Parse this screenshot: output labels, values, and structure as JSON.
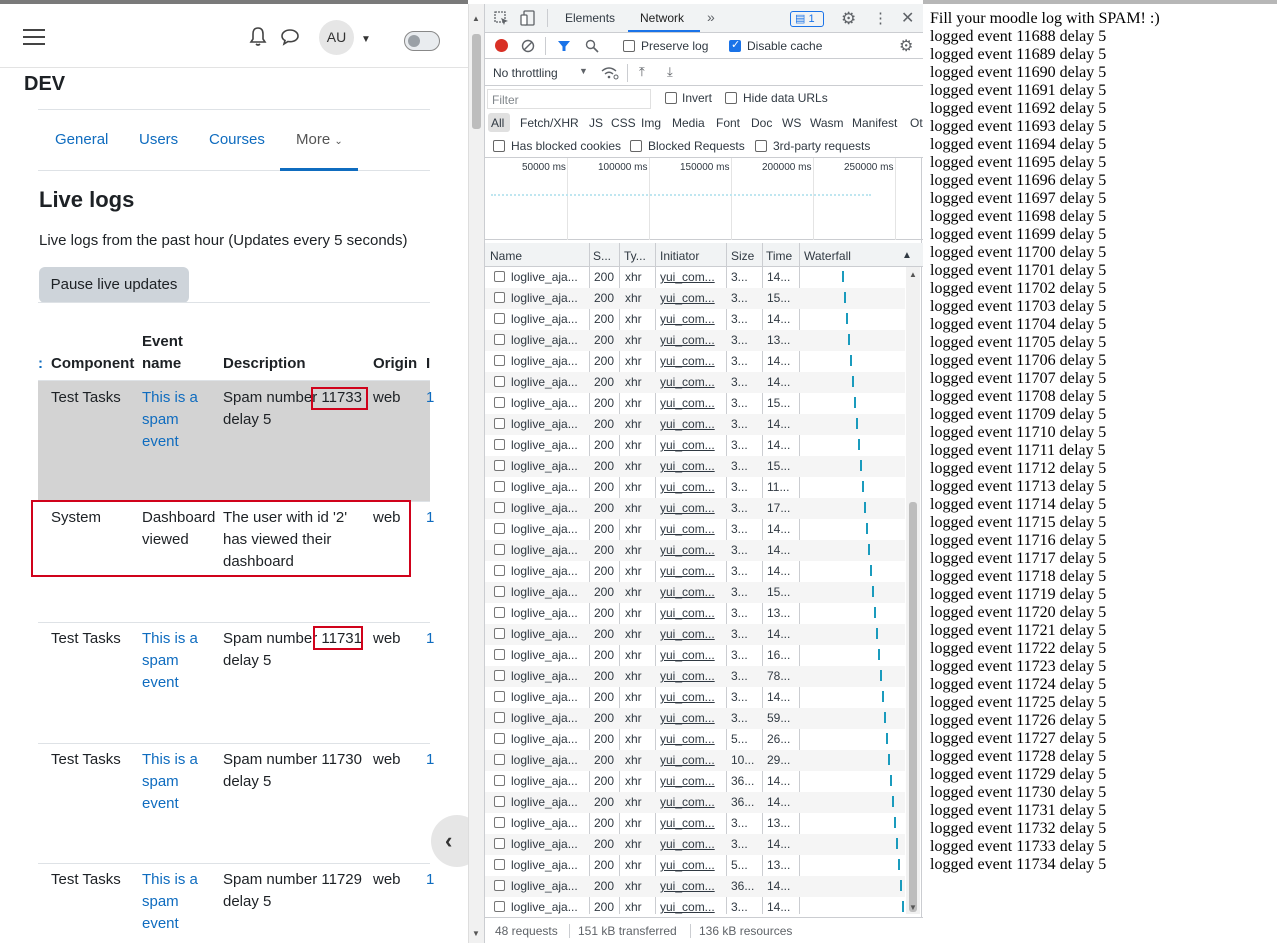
{
  "moodle": {
    "avatar_initials": "AU",
    "course_title": "DEV",
    "tabs": [
      {
        "label": "General"
      },
      {
        "label": "Users"
      },
      {
        "label": "Courses"
      },
      {
        "label": "More"
      }
    ],
    "heading": "Live logs",
    "subtitle": "Live logs from the past hour (Updates every 5 seconds)",
    "pause_button": "Pause live updates",
    "table": {
      "headers": {
        "component": "Component",
        "event_name_1": "Event",
        "event_name_2": "name",
        "description": "Description",
        "origin": "Origin"
      },
      "rows": [
        {
          "component": "Test Tasks",
          "event": [
            "This is a",
            "spam",
            "event"
          ],
          "desc": [
            "Spam number 11733",
            "delay 5"
          ],
          "origin": "web"
        },
        {
          "component": "System",
          "event": [
            "Dashboard",
            "viewed"
          ],
          "desc": [
            "The user with id '2'",
            "has viewed their",
            "dashboard"
          ],
          "origin": "web"
        },
        {
          "component": "Test Tasks",
          "event": [
            "This is a",
            "spam",
            "event"
          ],
          "desc": [
            "Spam number 11731",
            "delay 5"
          ],
          "origin": "web"
        },
        {
          "component": "Test Tasks",
          "event": [
            "This is a",
            "spam",
            "event"
          ],
          "desc": [
            "Spam number 11730",
            "delay 5"
          ],
          "origin": "web"
        },
        {
          "component": "Test Tasks",
          "event": [
            "This is a",
            "spam",
            "event"
          ],
          "desc": [
            "Spam number 11729",
            "delay 5"
          ],
          "origin": "web"
        }
      ]
    }
  },
  "devtools": {
    "tabs": {
      "elements": "Elements",
      "network": "Network",
      "more": "»"
    },
    "issues_count": "1",
    "preserve_log": "Preserve log",
    "disable_cache": "Disable cache",
    "throttling": "No throttling",
    "filter_placeholder": "Filter",
    "invert": "Invert",
    "hide_data_urls": "Hide data URLs",
    "type_filters": [
      "All",
      "Fetch/XHR",
      "JS",
      "CSS",
      "Img",
      "Media",
      "Font",
      "Doc",
      "WS",
      "Wasm",
      "Manifest",
      "Ot"
    ],
    "has_blocked_cookies": "Has blocked cookies",
    "blocked_requests": "Blocked Requests",
    "third_party": "3rd-party requests",
    "overview_ticks": [
      "50000 ms",
      "100000 ms",
      "150000 ms",
      "200000 ms",
      "250000 ms"
    ],
    "columns": {
      "name": "Name",
      "status": "S...",
      "type": "Ty...",
      "initiator": "Initiator",
      "size": "Size",
      "time": "Time",
      "waterfall": "Waterfall"
    },
    "requests": [
      {
        "name": "loglive_aja...",
        "status": "200",
        "type": "xhr",
        "initiator": "yui_com...",
        "size": "3...",
        "time": "14..."
      },
      {
        "name": "loglive_aja...",
        "status": "200",
        "type": "xhr",
        "initiator": "yui_com...",
        "size": "3...",
        "time": "15..."
      },
      {
        "name": "loglive_aja...",
        "status": "200",
        "type": "xhr",
        "initiator": "yui_com...",
        "size": "3...",
        "time": "14..."
      },
      {
        "name": "loglive_aja...",
        "status": "200",
        "type": "xhr",
        "initiator": "yui_com...",
        "size": "3...",
        "time": "13..."
      },
      {
        "name": "loglive_aja...",
        "status": "200",
        "type": "xhr",
        "initiator": "yui_com...",
        "size": "3...",
        "time": "14..."
      },
      {
        "name": "loglive_aja...",
        "status": "200",
        "type": "xhr",
        "initiator": "yui_com...",
        "size": "3...",
        "time": "14..."
      },
      {
        "name": "loglive_aja...",
        "status": "200",
        "type": "xhr",
        "initiator": "yui_com...",
        "size": "3...",
        "time": "15..."
      },
      {
        "name": "loglive_aja...",
        "status": "200",
        "type": "xhr",
        "initiator": "yui_com...",
        "size": "3...",
        "time": "14..."
      },
      {
        "name": "loglive_aja...",
        "status": "200",
        "type": "xhr",
        "initiator": "yui_com...",
        "size": "3...",
        "time": "14..."
      },
      {
        "name": "loglive_aja...",
        "status": "200",
        "type": "xhr",
        "initiator": "yui_com...",
        "size": "3...",
        "time": "15..."
      },
      {
        "name": "loglive_aja...",
        "status": "200",
        "type": "xhr",
        "initiator": "yui_com...",
        "size": "3...",
        "time": "11..."
      },
      {
        "name": "loglive_aja...",
        "status": "200",
        "type": "xhr",
        "initiator": "yui_com...",
        "size": "3...",
        "time": "17..."
      },
      {
        "name": "loglive_aja...",
        "status": "200",
        "type": "xhr",
        "initiator": "yui_com...",
        "size": "3...",
        "time": "14..."
      },
      {
        "name": "loglive_aja...",
        "status": "200",
        "type": "xhr",
        "initiator": "yui_com...",
        "size": "3...",
        "time": "14..."
      },
      {
        "name": "loglive_aja...",
        "status": "200",
        "type": "xhr",
        "initiator": "yui_com...",
        "size": "3...",
        "time": "14..."
      },
      {
        "name": "loglive_aja...",
        "status": "200",
        "type": "xhr",
        "initiator": "yui_com...",
        "size": "3...",
        "time": "15..."
      },
      {
        "name": "loglive_aja...",
        "status": "200",
        "type": "xhr",
        "initiator": "yui_com...",
        "size": "3...",
        "time": "13..."
      },
      {
        "name": "loglive_aja...",
        "status": "200",
        "type": "xhr",
        "initiator": "yui_com...",
        "size": "3...",
        "time": "14..."
      },
      {
        "name": "loglive_aja...",
        "status": "200",
        "type": "xhr",
        "initiator": "yui_com...",
        "size": "3...",
        "time": "16..."
      },
      {
        "name": "loglive_aja...",
        "status": "200",
        "type": "xhr",
        "initiator": "yui_com...",
        "size": "3...",
        "time": "78..."
      },
      {
        "name": "loglive_aja...",
        "status": "200",
        "type": "xhr",
        "initiator": "yui_com...",
        "size": "3...",
        "time": "14..."
      },
      {
        "name": "loglive_aja...",
        "status": "200",
        "type": "xhr",
        "initiator": "yui_com...",
        "size": "3...",
        "time": "59..."
      },
      {
        "name": "loglive_aja...",
        "status": "200",
        "type": "xhr",
        "initiator": "yui_com...",
        "size": "5...",
        "time": "26..."
      },
      {
        "name": "loglive_aja...",
        "status": "200",
        "type": "xhr",
        "initiator": "yui_com...",
        "size": "10...",
        "time": "29..."
      },
      {
        "name": "loglive_aja...",
        "status": "200",
        "type": "xhr",
        "initiator": "yui_com...",
        "size": "36...",
        "time": "14..."
      },
      {
        "name": "loglive_aja...",
        "status": "200",
        "type": "xhr",
        "initiator": "yui_com...",
        "size": "36...",
        "time": "14..."
      },
      {
        "name": "loglive_aja...",
        "status": "200",
        "type": "xhr",
        "initiator": "yui_com...",
        "size": "3...",
        "time": "13..."
      },
      {
        "name": "loglive_aja...",
        "status": "200",
        "type": "xhr",
        "initiator": "yui_com...",
        "size": "3...",
        "time": "14..."
      },
      {
        "name": "loglive_aja...",
        "status": "200",
        "type": "xhr",
        "initiator": "yui_com...",
        "size": "5...",
        "time": "13..."
      },
      {
        "name": "loglive_aja...",
        "status": "200",
        "type": "xhr",
        "initiator": "yui_com...",
        "size": "36...",
        "time": "14..."
      },
      {
        "name": "loglive_aja...",
        "status": "200",
        "type": "xhr",
        "initiator": "yui_com...",
        "size": "3...",
        "time": "14..."
      }
    ],
    "status_bar": {
      "requests": "48 requests",
      "transferred": "151 kB transferred",
      "resources": "136 kB resources"
    }
  },
  "log_output": {
    "title": "Fill your moodle log with SPAM! :)",
    "lines": [
      "logged event 11688 delay 5",
      "logged event 11689 delay 5",
      "logged event 11690 delay 5",
      "logged event 11691 delay 5",
      "logged event 11692 delay 5",
      "logged event 11693 delay 5",
      "logged event 11694 delay 5",
      "logged event 11695 delay 5",
      "logged event 11696 delay 5",
      "logged event 11697 delay 5",
      "logged event 11698 delay 5",
      "logged event 11699 delay 5",
      "logged event 11700 delay 5",
      "logged event 11701 delay 5",
      "logged event 11702 delay 5",
      "logged event 11703 delay 5",
      "logged event 11704 delay 5",
      "logged event 11705 delay 5",
      "logged event 11706 delay 5",
      "logged event 11707 delay 5",
      "logged event 11708 delay 5",
      "logged event 11709 delay 5",
      "logged event 11710 delay 5",
      "logged event 11711 delay 5",
      "logged event 11712 delay 5",
      "logged event 11713 delay 5",
      "logged event 11714 delay 5",
      "logged event 11715 delay 5",
      "logged event 11716 delay 5",
      "logged event 11717 delay 5",
      "logged event 11718 delay 5",
      "logged event 11719 delay 5",
      "logged event 11720 delay 5",
      "logged event 11721 delay 5",
      "logged event 11722 delay 5",
      "logged event 11723 delay 5",
      "logged event 11724 delay 5",
      "logged event 11725 delay 5",
      "logged event 11726 delay 5",
      "logged event 11727 delay 5",
      "logged event 11728 delay 5",
      "logged event 11729 delay 5",
      "logged event 11730 delay 5",
      "logged event 11731 delay 5",
      "logged event 11732 delay 5",
      "logged event 11733 delay 5",
      "logged event 11734 delay 5"
    ]
  },
  "colors": {
    "link": "#0f6cbf",
    "highlight_box": "#d0021b",
    "devtools_accent": "#1a73e8",
    "waterfall_bar": "#1a9bbd"
  }
}
